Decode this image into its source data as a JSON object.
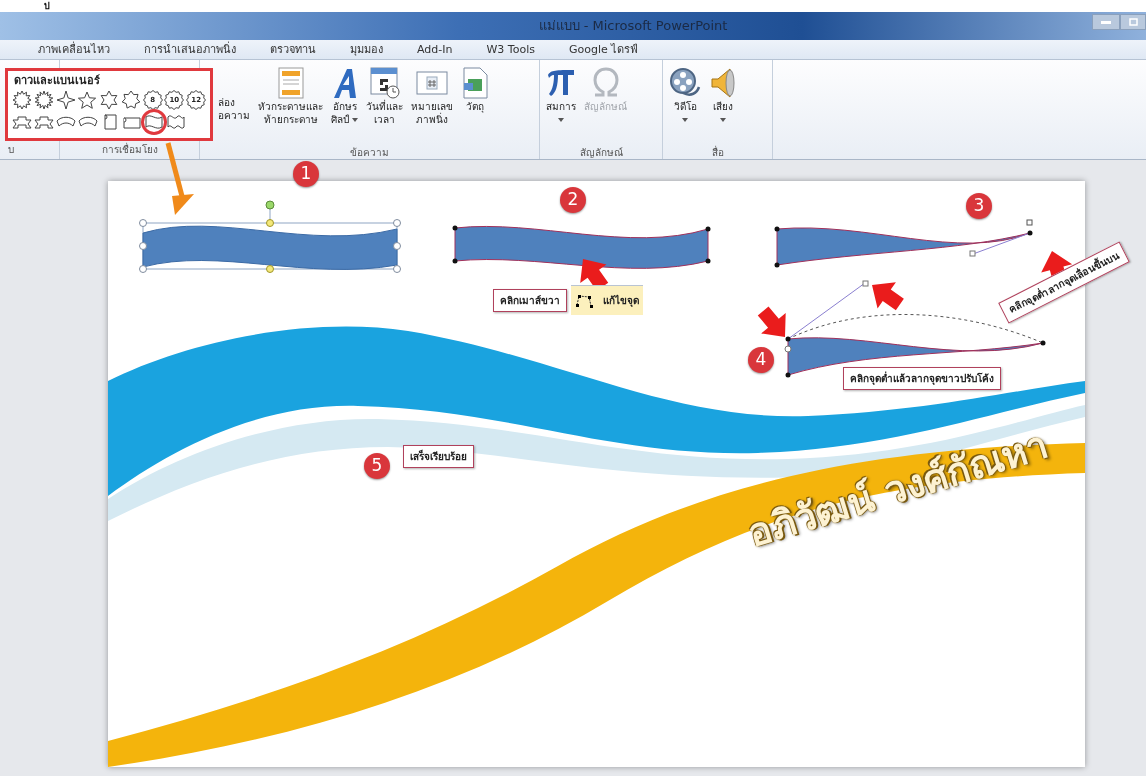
{
  "top_fragment": "ป",
  "window": {
    "title": "แม่แบบ - Microsoft PowerPoint"
  },
  "tabs": [
    {
      "label": "ภาพเคลื่อนไหว"
    },
    {
      "label": "การนำเสนอภาพนิ่ง"
    },
    {
      "label": "ตรวจทาน"
    },
    {
      "label": "มุมมอง"
    },
    {
      "label": "Add-In"
    },
    {
      "label": "W3 Tools"
    },
    {
      "label": "Google ไดรฟ์"
    }
  ],
  "ribbon": {
    "partial_button": {
      "lines": [
        "ล่อง",
        "อความ"
      ]
    },
    "groups": [
      {
        "label": "บ"
      },
      {
        "label": "การเชื่อมโยง"
      },
      {
        "label": "ข้อความ",
        "buttons": [
          {
            "kind": "header",
            "lines": [
              "หัวกระดาษและ",
              "ท้ายกระดาษ"
            ],
            "dropdown": false,
            "disabled": false
          },
          {
            "kind": "wordart",
            "lines": [
              "อักษร",
              "ศิลป์"
            ],
            "dropdown": true,
            "disabled": false
          },
          {
            "kind": "datetime",
            "lines": [
              "วันที่และ",
              "เวลา"
            ],
            "dropdown": false,
            "disabled": false
          },
          {
            "kind": "slidenumber",
            "lines": [
              "หมายเลข",
              "ภาพนิ่ง"
            ],
            "dropdown": false,
            "disabled": false
          },
          {
            "kind": "object",
            "lines": [
              "วัตถุ"
            ],
            "dropdown": false,
            "disabled": false
          }
        ]
      },
      {
        "label": "สัญลักษณ์",
        "buttons": [
          {
            "kind": "equation",
            "lines": [
              "สมการ"
            ],
            "dropdown": true,
            "disabled": false
          },
          {
            "kind": "symbol",
            "lines": [
              "สัญลักษณ์"
            ],
            "dropdown": false,
            "disabled": true
          }
        ]
      },
      {
        "label": "สื่อ",
        "buttons": [
          {
            "kind": "video",
            "lines": [
              "วิดีโอ"
            ],
            "dropdown": true,
            "disabled": false
          },
          {
            "kind": "audio",
            "lines": [
              "เสียง"
            ],
            "dropdown": true,
            "disabled": false
          }
        ]
      }
    ]
  },
  "shapes_gallery": {
    "title": "ดาวและแบนเนอร์",
    "rows": [
      [
        {
          "kind": "burst",
          "selected": false
        },
        {
          "kind": "burst2",
          "selected": false
        },
        {
          "kind": "star4",
          "selected": false
        },
        {
          "kind": "star5",
          "selected": false
        },
        {
          "kind": "star6",
          "selected": false
        },
        {
          "kind": "star7",
          "selected": false
        },
        {
          "kind": "badge",
          "label": "8",
          "selected": false
        },
        {
          "kind": "badge",
          "label": "10",
          "selected": false
        },
        {
          "kind": "badge",
          "label": "12",
          "selected": false
        }
      ],
      [
        {
          "kind": "ribbon",
          "selected": false
        },
        {
          "kind": "ribbon",
          "selected": false
        },
        {
          "kind": "curved-ribbon",
          "selected": false
        },
        {
          "kind": "curved-ribbon",
          "selected": false
        },
        {
          "kind": "vscroll",
          "selected": false
        },
        {
          "kind": "hscroll",
          "selected": false
        },
        {
          "kind": "wave",
          "selected": true
        },
        {
          "kind": "double-wave",
          "selected": false
        }
      ]
    ]
  },
  "slide": {
    "steps": [
      {
        "number": "1"
      },
      {
        "number": "2"
      },
      {
        "number": "3"
      },
      {
        "number": "4"
      },
      {
        "number": "5"
      }
    ],
    "callouts": [
      {
        "text": "คลิกเมาส์ขวา"
      },
      {
        "text": "คลิกจุดต่ำลากจุดเลื่อนขึ้นบน"
      },
      {
        "text": "คลิกจุดต่ำแล้วลากจุดขาวปรับโค้ง"
      },
      {
        "text": "เสร็จเรียบร้อย"
      }
    ],
    "context_menu_item": {
      "label": "แก้ไขจุด"
    },
    "wordart": "อภิวัฒน์ วงศ์กัณหา"
  }
}
